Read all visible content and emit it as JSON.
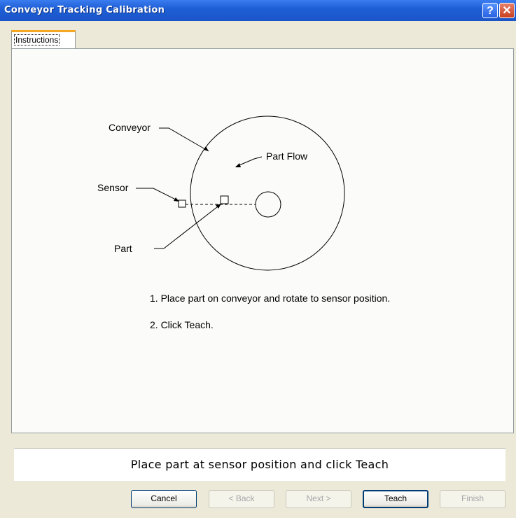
{
  "window": {
    "title": "Conveyor Tracking Calibration",
    "help_glyph": "?",
    "close_glyph": "✕"
  },
  "tabs": [
    {
      "label": "Instructions",
      "selected": true
    }
  ],
  "diagram": {
    "labels": {
      "conveyor": "Conveyor",
      "part_flow": "Part Flow",
      "sensor": "Sensor",
      "part": "Part"
    }
  },
  "instructions": [
    "1. Place part on conveyor and rotate to sensor position.",
    "2. Click Teach."
  ],
  "status_message": "Place part at sensor position and click Teach",
  "buttons": {
    "cancel": "Cancel",
    "back": "< Back",
    "next": "Next >",
    "teach": "Teach",
    "finish": "Finish"
  },
  "colors": {
    "titlebar": "#1f5fd6",
    "tab_accent": "#f5a623",
    "close_button": "#c8401f"
  }
}
